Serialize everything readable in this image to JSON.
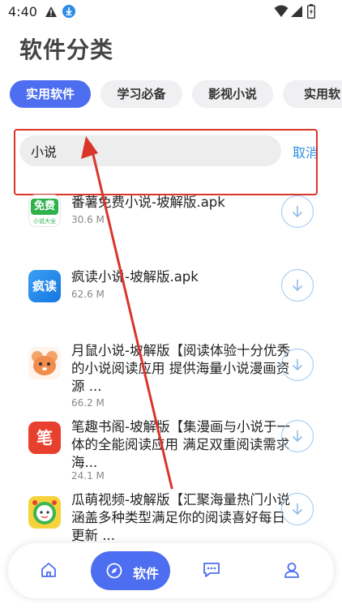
{
  "status": {
    "time": "4:40"
  },
  "page": {
    "title": "软件分类"
  },
  "tabs": [
    {
      "label": "实用软件",
      "active": true
    },
    {
      "label": "学习必备",
      "active": false
    },
    {
      "label": "影视小说",
      "active": false
    },
    {
      "label": "实用软",
      "active": false
    }
  ],
  "search": {
    "value": "小说",
    "cancel_label": "取消"
  },
  "items": [
    {
      "title": "番薯免费小说-坡解版.apk",
      "size": "30.6 M",
      "icon_text": "免费",
      "icon_sub": "小说大全"
    },
    {
      "title": "疯读小说-坡解版.apk",
      "size": "62.6 M",
      "icon_text": "疯读"
    },
    {
      "title": "月鼠小说-坡解版【阅读体验十分优秀的小说阅读应用 提供海量小说漫画资源 ...",
      "size": "66.2 M"
    },
    {
      "title": "笔趣书阁-坡解版【集漫画与小说于一体的全能阅读应用 满足双重阅读需求 海...",
      "size": "24.1 M",
      "icon_text": "笔"
    },
    {
      "title": "瓜萌视频-坡解版【汇聚海量热门小说涵盖多种类型满足你的阅读喜好每日更新 ...",
      "size": ""
    }
  ],
  "nav": {
    "active_label": "软件"
  },
  "colors": {
    "accent": "#4d6ef0",
    "link": "#2f8ee5",
    "annotation": "#d9352b"
  }
}
